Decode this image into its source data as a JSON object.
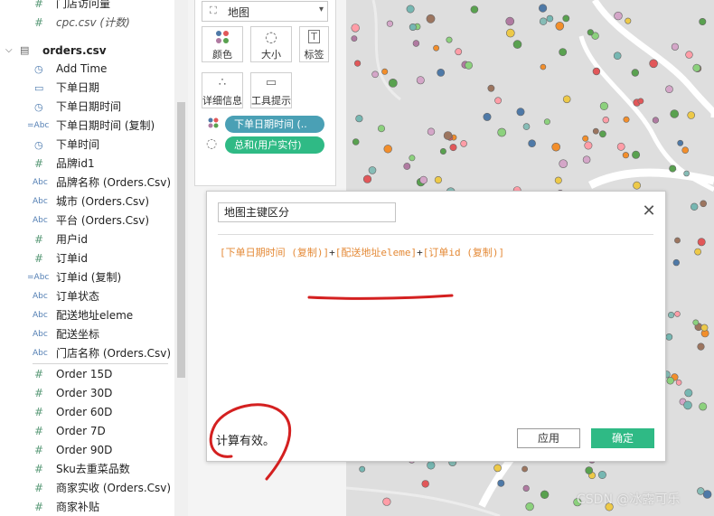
{
  "data_pane": {
    "top_fields": [
      {
        "icon": "number-icon",
        "label": "门店访问量",
        "italic": false
      },
      {
        "icon": "number-icon",
        "label": "cpc.csv (计数)",
        "italic": true
      }
    ],
    "datasource": {
      "name": "orders.csv",
      "icon": "table-icon"
    },
    "fields": [
      {
        "icon": "datetime-icon",
        "glyph": "◷",
        "label": "Add Time"
      },
      {
        "icon": "date-icon",
        "glyph": "▭",
        "label": "下单日期"
      },
      {
        "icon": "datetime-icon",
        "glyph": "◷",
        "label": "下单日期时间"
      },
      {
        "icon": "calc-string-icon",
        "glyph": "=Abc",
        "label": "下单日期时间 (复制)"
      },
      {
        "icon": "datetime-icon",
        "glyph": "◷",
        "label": "下单时间"
      },
      {
        "icon": "number-icon",
        "glyph": "#",
        "label": "品牌id1"
      },
      {
        "icon": "string-icon",
        "glyph": "Abc",
        "label": "品牌名称 (Orders.Csv)"
      },
      {
        "icon": "string-icon",
        "glyph": "Abc",
        "label": "城市 (Orders.Csv)"
      },
      {
        "icon": "string-icon",
        "glyph": "Abc",
        "label": "平台 (Orders.Csv)"
      },
      {
        "icon": "number-icon",
        "glyph": "#",
        "label": "用户id"
      },
      {
        "icon": "number-icon",
        "glyph": "#",
        "label": "订单id"
      },
      {
        "icon": "calc-string-icon",
        "glyph": "=Abc",
        "label": "订单id (复制)"
      },
      {
        "icon": "string-icon",
        "glyph": "Abc",
        "label": "订单状态"
      },
      {
        "icon": "string-icon",
        "glyph": "Abc",
        "label": "配送地址eleme"
      },
      {
        "icon": "string-icon",
        "glyph": "Abc",
        "label": "配送坐标"
      },
      {
        "icon": "string-icon",
        "glyph": "Abc",
        "label": "门店名称 (Orders.Csv)"
      }
    ],
    "measures": [
      {
        "icon": "number-icon",
        "glyph": "#",
        "label": "Order 15D"
      },
      {
        "icon": "number-icon",
        "glyph": "#",
        "label": "Order 30D"
      },
      {
        "icon": "number-icon",
        "glyph": "#",
        "label": "Order 60D"
      },
      {
        "icon": "number-icon",
        "glyph": "#",
        "label": "Order 7D"
      },
      {
        "icon": "number-icon",
        "glyph": "#",
        "label": "Order 90D"
      },
      {
        "icon": "number-icon",
        "glyph": "#",
        "label": "Sku去重菜品数"
      },
      {
        "icon": "number-icon",
        "glyph": "#",
        "label": "商家实收 (Orders.Csv)"
      },
      {
        "icon": "number-icon",
        "glyph": "#",
        "label": "商家补贴"
      }
    ]
  },
  "marks": {
    "mark_type": "地图",
    "buttons": [
      {
        "name": "color",
        "label": "颜色",
        "glyph": "⁘"
      },
      {
        "name": "size",
        "label": "大小",
        "glyph": "◌"
      },
      {
        "name": "label",
        "label": "标签",
        "glyph": "T"
      },
      {
        "name": "detail",
        "label": "详细信息",
        "glyph": "∴"
      },
      {
        "name": "tooltip",
        "label": "工具提示",
        "glyph": "▢"
      }
    ],
    "pills": [
      {
        "label": "下单日期时间 (..",
        "color": "#4aa0b5"
      },
      {
        "label": "总和(用户实付)",
        "color": "#2fba85"
      }
    ]
  },
  "dialog": {
    "name_value": "地图主键区分",
    "close_glyph": "✕",
    "formula": {
      "part1": "[下单日期时间 (复制)]",
      "op1": "+",
      "part2": "[配送地址eleme]",
      "op2": "+",
      "part3": "[订单id (复制)]"
    },
    "status": "计算有效。",
    "apply_label": "应用",
    "ok_label": "确定"
  },
  "colors": {
    "accent_green": "#2fba85",
    "pill_teal": "#4aa0b5",
    "formula_field": "#e48a37",
    "annotation_red": "#d42020",
    "map_bg": "#dedede"
  },
  "watermark": "CSDN @冰露可乐"
}
